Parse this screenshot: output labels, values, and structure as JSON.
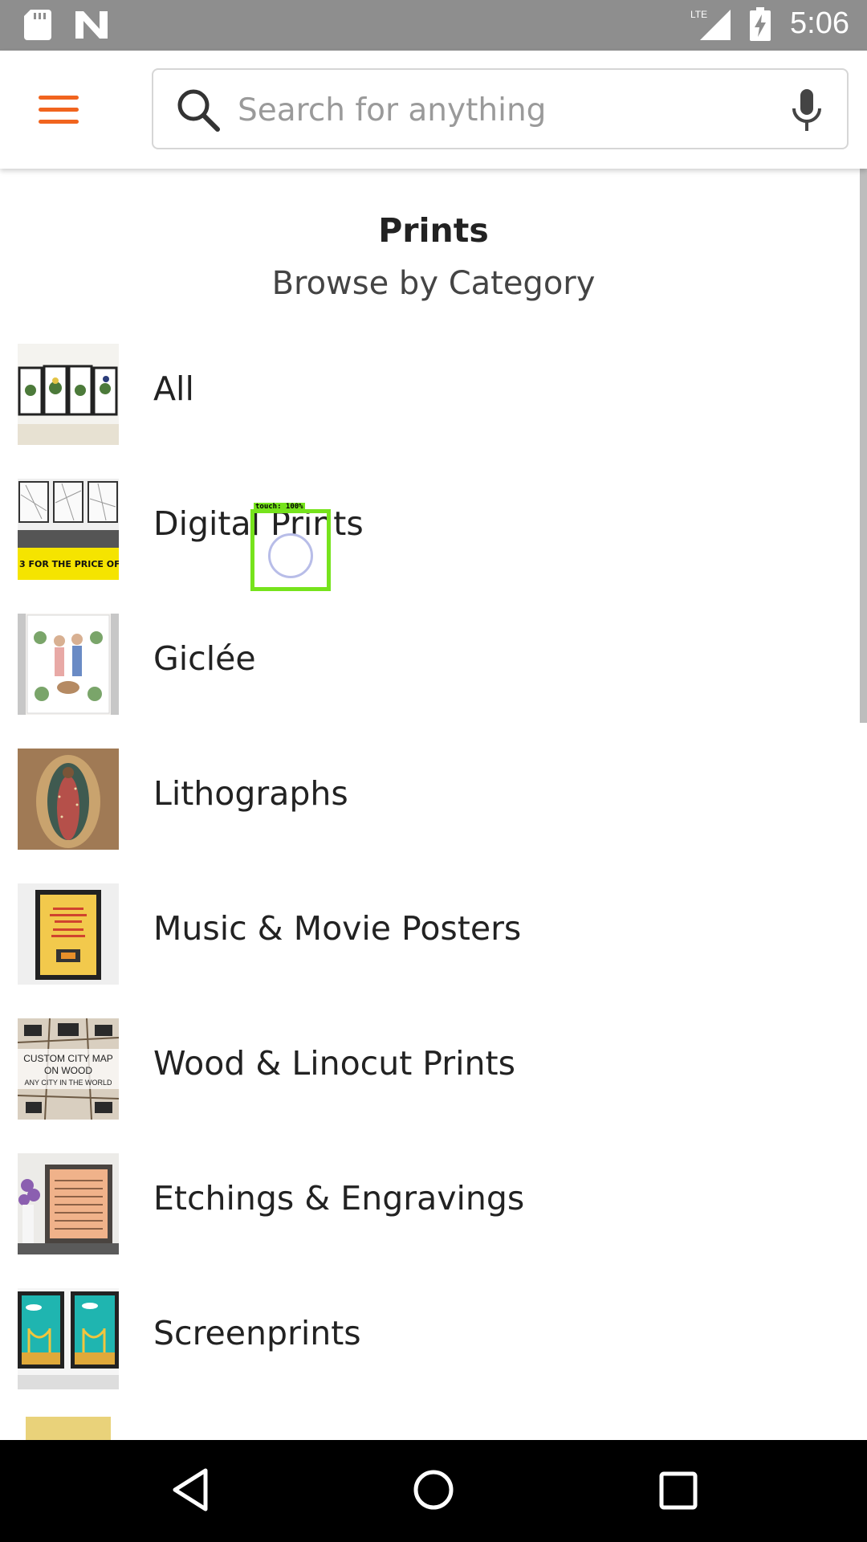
{
  "status_bar": {
    "time": "5:06",
    "network": "LTE",
    "icons": [
      "sd-card-icon",
      "n-notification-icon",
      "signal-icon",
      "battery-charging-icon"
    ]
  },
  "app_bar": {
    "menu_icon": "hamburger-menu-icon",
    "search": {
      "placeholder": "Search for anything",
      "value": ""
    },
    "mic_icon": "microphone-icon",
    "accent_color": "#f1641e"
  },
  "header": {
    "title": "Prints",
    "subtitle": "Browse by Category"
  },
  "categories": [
    {
      "label": "All",
      "thumb": "botanical-prints-thumbnail"
    },
    {
      "label": "Digital Prints",
      "thumb": "city-map-prints-thumbnail"
    },
    {
      "label": "Giclée",
      "thumb": "couple-portrait-thumbnail"
    },
    {
      "label": "Lithographs",
      "thumb": "virgin-guadalupe-thumbnail"
    },
    {
      "label": "Music & Movie Posters",
      "thumb": "framed-poster-thumbnail"
    },
    {
      "label": "Wood & Linocut Prints",
      "thumb": "custom-city-map-wood-thumbnail"
    },
    {
      "label": "Etchings & Engravings",
      "thumb": "framed-sheet-music-thumbnail"
    },
    {
      "label": "Screenprints",
      "thumb": "bridge-screenprint-thumbnail"
    }
  ],
  "touch_indicator": {
    "label": "touch: 100%"
  },
  "nav_bar": {
    "icons": [
      "back-icon",
      "home-icon",
      "recents-icon"
    ]
  }
}
